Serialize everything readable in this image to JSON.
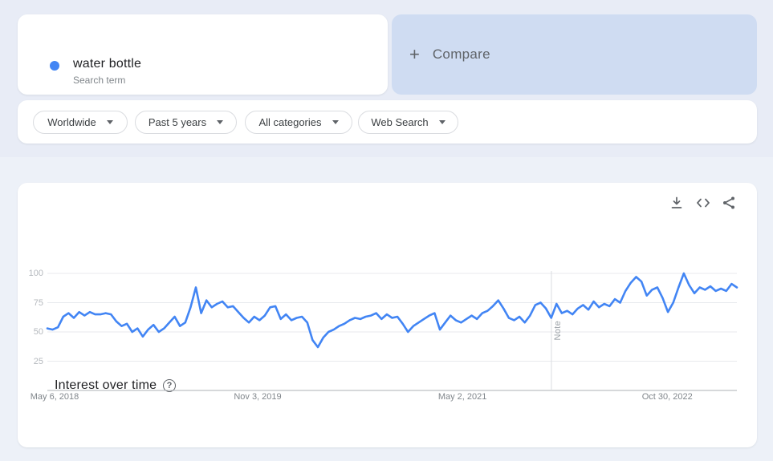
{
  "search_card": {
    "term": "water bottle",
    "type_label": "Search term",
    "dot_color": "#4285f4"
  },
  "compare_card": {
    "plus": "+",
    "label": "Compare"
  },
  "filters": [
    {
      "label": "Worldwide"
    },
    {
      "label": "Past 5 years"
    },
    {
      "label": "All categories"
    },
    {
      "label": "Web Search"
    }
  ],
  "chart_card": {
    "title": "Interest over time",
    "help_glyph": "?",
    "actions": [
      "download-icon",
      "embed-icon",
      "share-icon"
    ],
    "note_label": "Note"
  },
  "chart_data": {
    "type": "line",
    "title": "Interest over time",
    "legend": "none",
    "grid": true,
    "ylim": [
      0,
      100
    ],
    "y_ticks": [
      100,
      75,
      50,
      25
    ],
    "x_tick_labels": [
      "May 6, 2018",
      "Nov 3, 2019",
      "May 2, 2021",
      "Oct 30, 2022"
    ],
    "x_tick_fractions": [
      0.0105,
      0.305,
      0.602,
      0.899
    ],
    "note_fraction": 0.731,
    "series": [
      {
        "name": "water bottle",
        "color": "#4285f4",
        "values": [
          53,
          52,
          54,
          63,
          66,
          62,
          67,
          64,
          67,
          65,
          65,
          66,
          65,
          59,
          55,
          57,
          50,
          53,
          46,
          52,
          56,
          50,
          53,
          58,
          63,
          55,
          58,
          71,
          88,
          66,
          77,
          71,
          74,
          76,
          71,
          72,
          67,
          62,
          58,
          63,
          60,
          64,
          71,
          72,
          61,
          65,
          60,
          62,
          63,
          58,
          43,
          37,
          45,
          50,
          52,
          55,
          57,
          60,
          62,
          61,
          63,
          64,
          66,
          61,
          65,
          62,
          63,
          57,
          50,
          55,
          58,
          61,
          64,
          66,
          52,
          58,
          64,
          60,
          58,
          61,
          64,
          61,
          66,
          68,
          72,
          77,
          70,
          62,
          60,
          63,
          58,
          64,
          73,
          75,
          70,
          62,
          74,
          66,
          68,
          65,
          70,
          73,
          69,
          76,
          71,
          74,
          72,
          78,
          75,
          85,
          92,
          97,
          93,
          81,
          86,
          88,
          79,
          67,
          75,
          88,
          100,
          90,
          83,
          88,
          86,
          89,
          85,
          87,
          85,
          91,
          88
        ]
      }
    ],
    "colors": {
      "line": "#4285f4",
      "gridline": "#e8eaed",
      "axis": "#aeb1b6",
      "note_line": "#dadce0"
    }
  }
}
